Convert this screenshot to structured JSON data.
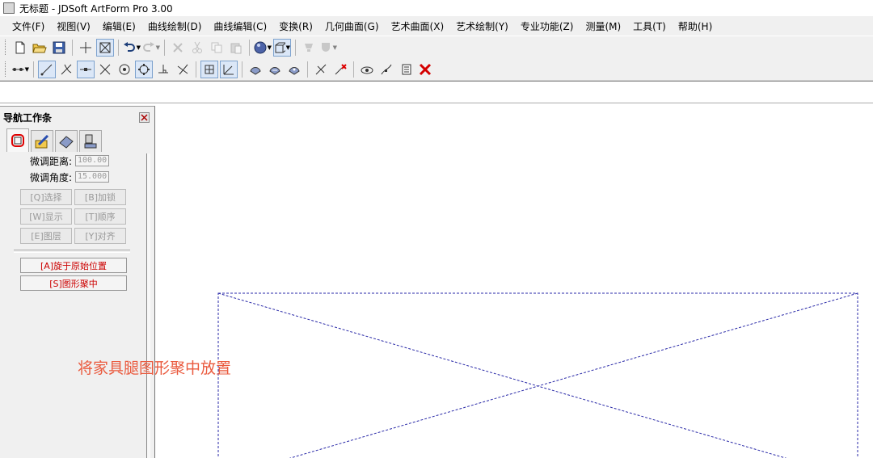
{
  "window": {
    "title": "无标题 - JDSoft ArtForm Pro 3.00"
  },
  "menu": {
    "items": [
      "文件(F)",
      "视图(V)",
      "编辑(E)",
      "曲线绘制(D)",
      "曲线编辑(C)",
      "变换(R)",
      "几何曲面(G)",
      "艺术曲面(X)",
      "艺术绘制(Y)",
      "专业功能(Z)",
      "测量(M)",
      "工具(T)",
      "帮助(H)"
    ]
  },
  "toolbar1": {
    "icons": [
      "new-file-icon",
      "open-folder-icon",
      "save-icon",
      "crosshair-icon",
      "zoom-window-icon",
      "undo-icon",
      "redo-icon",
      "delete-icon",
      "cut-icon",
      "copy-icon",
      "paste-icon",
      "sphere-render-icon",
      "cube-view-icon",
      "light-icon",
      "material-icon"
    ]
  },
  "toolbar2": {
    "icons": [
      "snap-mode-icon",
      "line-icon",
      "tangent-line-icon",
      "midpoint-line-icon",
      "cross-line-icon",
      "circle-center-icon",
      "quadrant-point-icon",
      "perpendicular-icon",
      "bisector-icon",
      "grid-snap-icon",
      "axis-icon",
      "surface-a-icon",
      "surface-b-icon",
      "surface-c-icon",
      "trim-point-icon",
      "delete-point-icon",
      "eye-view-icon",
      "point-edit-icon",
      "list-icon",
      "close-x-icon"
    ]
  },
  "panel": {
    "title": "导航工作条",
    "tabs": [
      "select-tab-icon",
      "draw-tab-icon",
      "surface-tab-icon",
      "tool-tab-icon"
    ],
    "fields": [
      {
        "label": "微调距离:",
        "value": "100.00"
      },
      {
        "label": "微调角度:",
        "value": "15.000"
      }
    ],
    "grid_buttons": [
      "[Q]选择",
      "[B]加锁",
      "[W]显示",
      "[T]顺序",
      "[E]图层",
      "[Y]对齐"
    ],
    "red_buttons": [
      "[A]旋于原始位置",
      "[S]图形聚中"
    ]
  },
  "annotation": {
    "text": "将家具腿图形聚中放置"
  },
  "colors": {
    "annotation": "#ea5a3e",
    "guide_lines": "#2a2aa8",
    "red_button_text": "#cc0000"
  }
}
